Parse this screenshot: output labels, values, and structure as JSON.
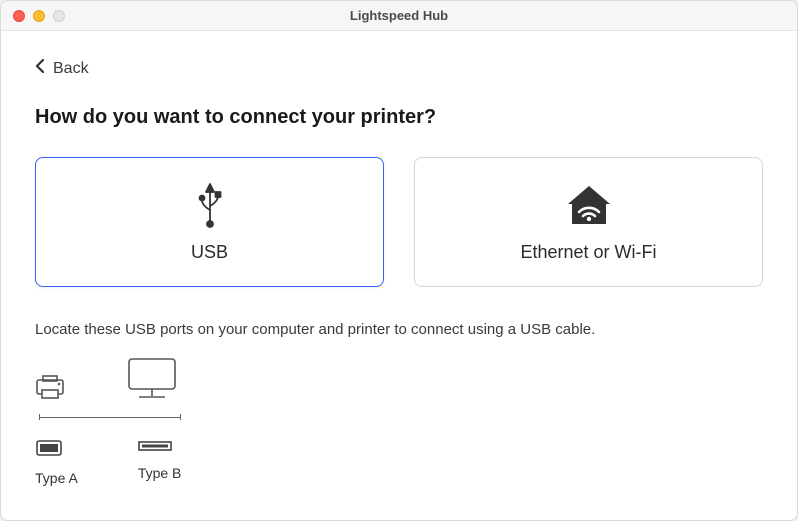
{
  "window": {
    "title": "Lightspeed Hub"
  },
  "nav": {
    "back_label": "Back"
  },
  "heading": "How do you want to connect your printer?",
  "options": {
    "usb": {
      "label": "USB"
    },
    "network": {
      "label": "Ethernet or Wi-Fi"
    }
  },
  "instruction": "Locate these USB ports on your computer and printer to connect using a USB cable.",
  "ports": {
    "a": {
      "label": "Type A"
    },
    "b": {
      "label": "Type B"
    }
  }
}
